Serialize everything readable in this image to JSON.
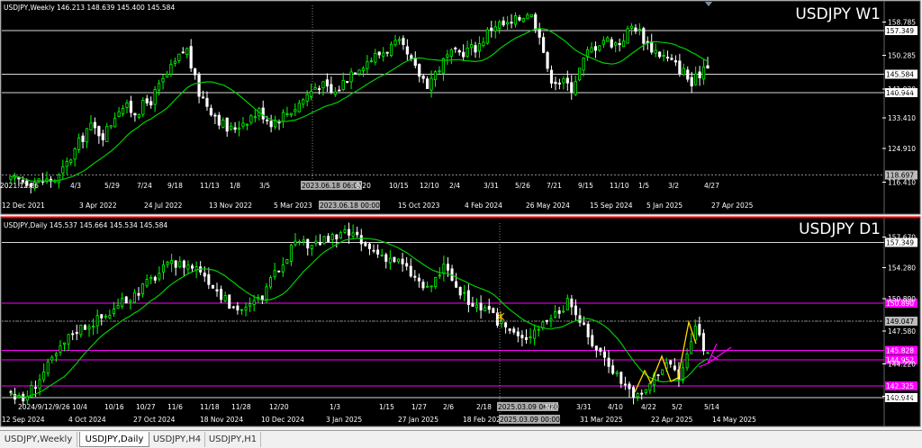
{
  "colors": {
    "background": "#000000",
    "bull": "#00ff00",
    "bear": "#ffffff",
    "ma": "#00cc00",
    "grid": "#7a7a7a",
    "axis_text": "#ffffff",
    "magenta": "#ff00ff",
    "yellow": "#ffd700",
    "highlight_line": "#ff0000"
  },
  "tabs": [
    {
      "label": "USDJPY,Weekly",
      "active": false
    },
    {
      "label": "USDJPY,Daily",
      "active": true
    },
    {
      "label": "USDJPY,H4",
      "active": false
    },
    {
      "label": "USDJPY,H1",
      "active": false
    }
  ],
  "panels": [
    {
      "id": "weekly",
      "header": "USDJPY,Weekly  146.213 148.639 145.400 145.584",
      "symbol_label": "USDJPY W1",
      "y_ticks": [
        "158.785",
        "150.285",
        "141.920",
        "133.410",
        "124.910",
        "116.410"
      ],
      "hlines": [
        {
          "label": "157.349",
          "color": "white"
        },
        {
          "label": "145.584",
          "color": "white"
        },
        {
          "label": "140.944",
          "color": "white"
        },
        {
          "label": "118.697",
          "color": "gray"
        }
      ],
      "x_ticks_top": [
        "2021.12.26",
        "4/3",
        "5/29",
        "7/24",
        "9/18",
        "11/13",
        "1/8",
        "3/5",
        "2023.06.18 06:00",
        "8/20",
        "10/15",
        "12/10",
        "2/4",
        "3/31",
        "5/26",
        "7/21",
        "9/15",
        "11/10",
        "1/5",
        "3/2",
        "4/27"
      ],
      "x_ticks_bottom": [
        "12 Dec 2021",
        "3 Apr 2022",
        "24 Jul 2022",
        "13 Nov 2022",
        "5 Mar 2023",
        "2023.06.18 00:00",
        "15 Oct 2023",
        "4 Feb 2024",
        "26 May 2024",
        "15 Sep 2024",
        "5 Jan 2025",
        "27 Apr 2025"
      ]
    },
    {
      "id": "daily",
      "header": "USDJPY,Daily  145.537 145.664 145.534 145.584",
      "symbol_label": "USDJPY D1",
      "y_ticks": [
        "157.670",
        "154.280",
        "150.890",
        "147.580",
        "144.220",
        "140.810"
      ],
      "hlines": [
        {
          "label": "157.349",
          "color": "white"
        },
        {
          "label": "150.890",
          "color": "magenta"
        },
        {
          "label": "149.047",
          "color": "gray"
        },
        {
          "label": "145.828",
          "color": "magenta"
        },
        {
          "label": "144.952",
          "color": "magenta"
        },
        {
          "label": "142.325",
          "color": "magenta"
        },
        {
          "label": "140.944",
          "color": "white"
        }
      ],
      "x_ticks_top": [
        "2024/9/12/9/26",
        "10/4",
        "10/16",
        "10/27",
        "11/6",
        "11/18",
        "11/28",
        "12/20",
        "1/3",
        "1/15",
        "1/27",
        "2/6",
        "2/18",
        "2025.03.09 06:00",
        "3/20",
        "3/31",
        "4/10",
        "4/22",
        "5/2",
        "5/14"
      ],
      "x_ticks_bottom": [
        "12 Sep 2024",
        "4 Oct 2024",
        "27 Oct 2024",
        "18 Nov 2024",
        "10 Dec 2024",
        "3 Jan 2025",
        "27 Jan 2025",
        "18 Feb 2025",
        "2025.03.09 00:00",
        "31 Mar 2025",
        "22 Apr 2025",
        "14 May 2025"
      ]
    }
  ],
  "chart_data": [
    {
      "type": "candlestick",
      "title": "USDJPY W1",
      "timeframe": "Weekly",
      "last_ohlc": {
        "open": 146.213,
        "high": 148.639,
        "low": 145.4,
        "close": 145.584
      },
      "ylim": [
        113.0,
        162.0
      ],
      "ma_period": "unlabeled",
      "close_path": [
        [
          "2021-12-12",
          115.1
        ],
        [
          "2021-12-26",
          115.3
        ],
        [
          "2022-01-30",
          115.0
        ],
        [
          "2022-03-06",
          115.6
        ],
        [
          "2022-04-03",
          122.5
        ],
        [
          "2022-05-01",
          130.0
        ],
        [
          "2022-05-29",
          127.5
        ],
        [
          "2022-06-26",
          135.5
        ],
        [
          "2022-07-24",
          133.8
        ],
        [
          "2022-08-21",
          137.0
        ],
        [
          "2022-09-18",
          143.5
        ],
        [
          "2022-10-16",
          149.5
        ],
        [
          "2022-10-23",
          151.5
        ],
        [
          "2022-11-13",
          139.5
        ],
        [
          "2022-12-04",
          135.0
        ],
        [
          "2023-01-08",
          128.5
        ],
        [
          "2023-02-05",
          131.5
        ],
        [
          "2023-03-05",
          134.0
        ],
        [
          "2023-03-26",
          131.0
        ],
        [
          "2023-05-07",
          135.0
        ],
        [
          "2023-06-18",
          141.5
        ],
        [
          "2023-07-16",
          138.5
        ],
        [
          "2023-08-20",
          145.5
        ],
        [
          "2023-09-17",
          147.8
        ],
        [
          "2023-10-29",
          151.5
        ],
        [
          "2023-11-12",
          151.8
        ],
        [
          "2023-12-10",
          145.0
        ],
        [
          "2023-12-31",
          141.5
        ],
        [
          "2024-02-04",
          148.5
        ],
        [
          "2024-03-03",
          150.0
        ],
        [
          "2024-03-31",
          151.5
        ],
        [
          "2024-04-28",
          157.5
        ],
        [
          "2024-05-26",
          157.0
        ],
        [
          "2024-06-30",
          161.0
        ],
        [
          "2024-07-21",
          155.0
        ],
        [
          "2024-08-04",
          143.5
        ],
        [
          "2024-09-15",
          140.5
        ],
        [
          "2024-10-13",
          149.5
        ],
        [
          "2024-11-10",
          153.5
        ],
        [
          "2024-12-08",
          152.0
        ],
        [
          "2025-01-05",
          157.5
        ],
        [
          "2025-02-02",
          151.5
        ],
        [
          "2025-03-02",
          148.5
        ],
        [
          "2025-04-06",
          144.5
        ],
        [
          "2025-04-20",
          140.8
        ],
        [
          "2025-05-11",
          146.2
        ],
        [
          "2025-05-18",
          145.584
        ]
      ]
    },
    {
      "type": "candlestick",
      "title": "USDJPY D1",
      "timeframe": "Daily",
      "last_ohlc": {
        "open": 145.537,
        "high": 145.664,
        "low": 145.534,
        "close": 145.584
      },
      "ylim": [
        139.8,
        159.0
      ],
      "ma_period": "unlabeled",
      "close_path": [
        [
          "2024-09-12",
          141.5
        ],
        [
          "2024-09-16",
          140.5
        ],
        [
          "2024-09-26",
          144.5
        ],
        [
          "2024-10-04",
          147.8
        ],
        [
          "2024-10-16",
          149.5
        ],
        [
          "2024-10-27",
          152.0
        ],
        [
          "2024-11-06",
          154.5
        ],
        [
          "2024-11-12",
          154.8
        ],
        [
          "2024-11-18",
          154.2
        ],
        [
          "2024-11-28",
          150.5
        ],
        [
          "2024-12-04",
          150.0
        ],
        [
          "2024-12-10",
          151.5
        ],
        [
          "2024-12-20",
          156.5
        ],
        [
          "2025-01-03",
          157.3
        ],
        [
          "2025-01-10",
          158.0
        ],
        [
          "2025-01-15",
          156.5
        ],
        [
          "2025-01-27",
          155.0
        ],
        [
          "2025-02-06",
          152.0
        ],
        [
          "2025-02-12",
          154.5
        ],
        [
          "2025-02-18",
          151.5
        ],
        [
          "2025-02-28",
          149.5
        ],
        [
          "2025-03-09",
          147.5
        ],
        [
          "2025-03-11",
          146.8
        ],
        [
          "2025-03-20",
          149.0
        ],
        [
          "2025-03-28",
          150.8
        ],
        [
          "2025-03-31",
          149.5
        ],
        [
          "2025-04-04",
          147.0
        ],
        [
          "2025-04-10",
          145.0
        ],
        [
          "2025-04-16",
          142.5
        ],
        [
          "2025-04-22",
          140.8
        ],
        [
          "2025-04-28",
          143.5
        ],
        [
          "2025-05-02",
          144.8
        ],
        [
          "2025-05-06",
          142.8
        ],
        [
          "2025-05-12",
          148.5
        ],
        [
          "2025-05-14",
          146.5
        ],
        [
          "2025-05-16",
          145.584
        ]
      ]
    }
  ]
}
